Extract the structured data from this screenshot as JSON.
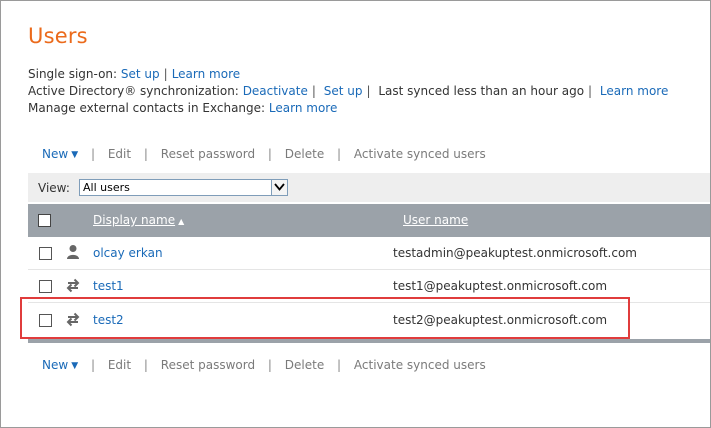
{
  "page": {
    "title": "Users"
  },
  "info": {
    "sso_label": "Single sign-on:",
    "sso_setup": "Set up",
    "sso_learn": "Learn more",
    "ad_label": "Active Directory® synchronization:",
    "ad_deactivate": "Deactivate",
    "ad_setup": "Set up",
    "ad_status": "Last synced less than an hour ago",
    "ad_learn": "Learn more",
    "contacts_label": "Manage external contacts in Exchange:",
    "contacts_learn": "Learn more",
    "separator": "|"
  },
  "toolbar": {
    "new": "New",
    "edit": "Edit",
    "reset": "Reset password",
    "delete": "Delete",
    "activate": "Activate synced users",
    "pipe": "|"
  },
  "filter": {
    "label": "View:",
    "value": "All users"
  },
  "table": {
    "col_display": "Display name",
    "col_user": "User name",
    "rows": [
      {
        "name": "olcay erkan",
        "email": "testadmin@peakuptest.onmicrosoft.com",
        "icon": "user-icon"
      },
      {
        "name": "test1",
        "email": "test1@peakuptest.onmicrosoft.com",
        "icon": "sync-icon"
      },
      {
        "name": "test2",
        "email": "test2@peakuptest.onmicrosoft.com",
        "icon": "sync-icon"
      }
    ]
  },
  "colors": {
    "title": "#eb6a1b",
    "link": "#1a6ab8",
    "header_bar": "#9ba2a9",
    "highlight": "#e03c3c"
  }
}
